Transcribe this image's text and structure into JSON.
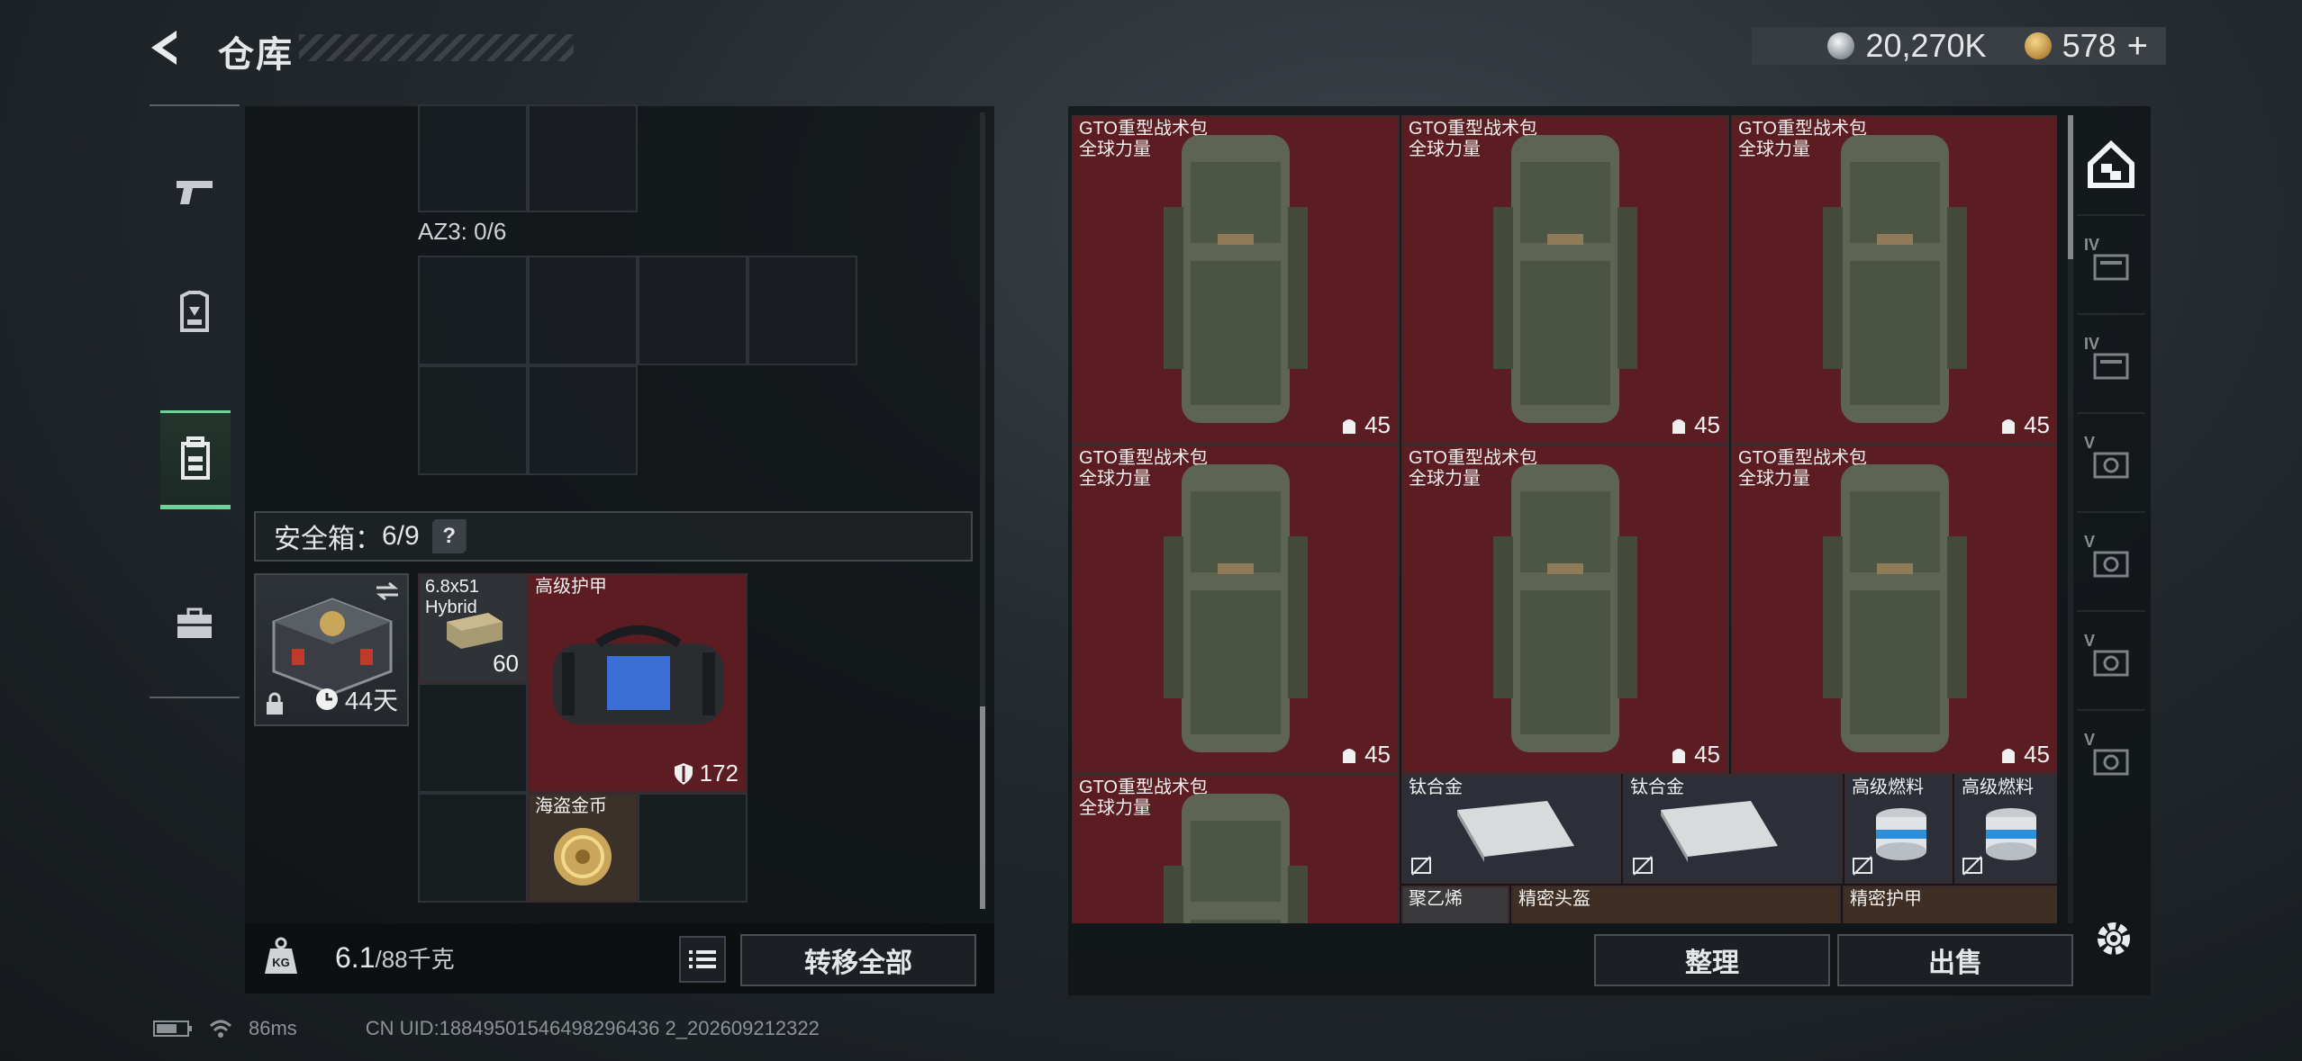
{
  "header": {
    "title": "仓库",
    "currency_silver": "20,270K",
    "currency_gold": "578",
    "add_symbol": "+"
  },
  "left_nav": {
    "items": [
      {
        "icon": "pistol-icon",
        "active": false
      },
      {
        "icon": "armor-icon",
        "active": false
      },
      {
        "icon": "backpack-icon",
        "active": true
      },
      {
        "icon": "toolbox-icon",
        "active": false
      }
    ]
  },
  "inventory": {
    "az3_label": "AZ3: 0/6",
    "safebox_label": "安全箱：",
    "safebox_count": "6/9",
    "help": "?",
    "safebox_days": "44天",
    "items": {
      "ammo": {
        "name": "6.8x51",
        "sub": "Hybrid",
        "count": "60"
      },
      "armor": {
        "name": "高级护甲",
        "durability": "172"
      },
      "coin": {
        "name": "海盗金币"
      }
    }
  },
  "weight": {
    "current": "6.1",
    "capacity": "/88千克",
    "icon_label": "KG"
  },
  "buttons": {
    "transfer_all": "转移全部",
    "sort": "整理",
    "sell": "出售"
  },
  "storage": {
    "bags": [
      {
        "name": "GTO重型战术包",
        "sub": "全球力量",
        "count": "45"
      },
      {
        "name": "GTO重型战术包",
        "sub": "全球力量",
        "count": "45"
      },
      {
        "name": "GTO重型战术包",
        "sub": "全球力量",
        "count": "45"
      },
      {
        "name": "GTO重型战术包",
        "sub": "全球力量",
        "count": "45"
      },
      {
        "name": "GTO重型战术包",
        "sub": "全球力量",
        "count": "45"
      },
      {
        "name": "GTO重型战术包",
        "sub": "全球力量",
        "count": "45"
      },
      {
        "name": "GTO重型战术包",
        "sub": "全球力量",
        "count": ""
      }
    ],
    "small_items": [
      {
        "name": "钛合金"
      },
      {
        "name": "钛合金"
      },
      {
        "name": "高级燃料"
      },
      {
        "name": "高级燃料"
      }
    ],
    "partial_row": [
      {
        "name": "聚乙烯"
      },
      {
        "name": "精密头盔"
      },
      {
        "name": "精密护甲"
      }
    ]
  },
  "right_tabs": [
    {
      "icon": "storage-all-icon",
      "roman": ""
    },
    {
      "icon": "storage-tab-icon",
      "roman": "IV"
    },
    {
      "icon": "storage-tab-icon",
      "roman": "IV"
    },
    {
      "icon": "storage-tab-icon",
      "roman": "V"
    },
    {
      "icon": "storage-tab-icon",
      "roman": "V"
    },
    {
      "icon": "storage-tab-icon",
      "roman": "V"
    },
    {
      "icon": "storage-tab-icon",
      "roman": "V"
    }
  ],
  "footer": {
    "ping": "86ms",
    "uid": "CN UID:18849501546498296436 2_202609212322"
  },
  "colors": {
    "accent_green": "#6ed39a",
    "item_red": "#5b1c22",
    "panel_dark": "#101316"
  }
}
